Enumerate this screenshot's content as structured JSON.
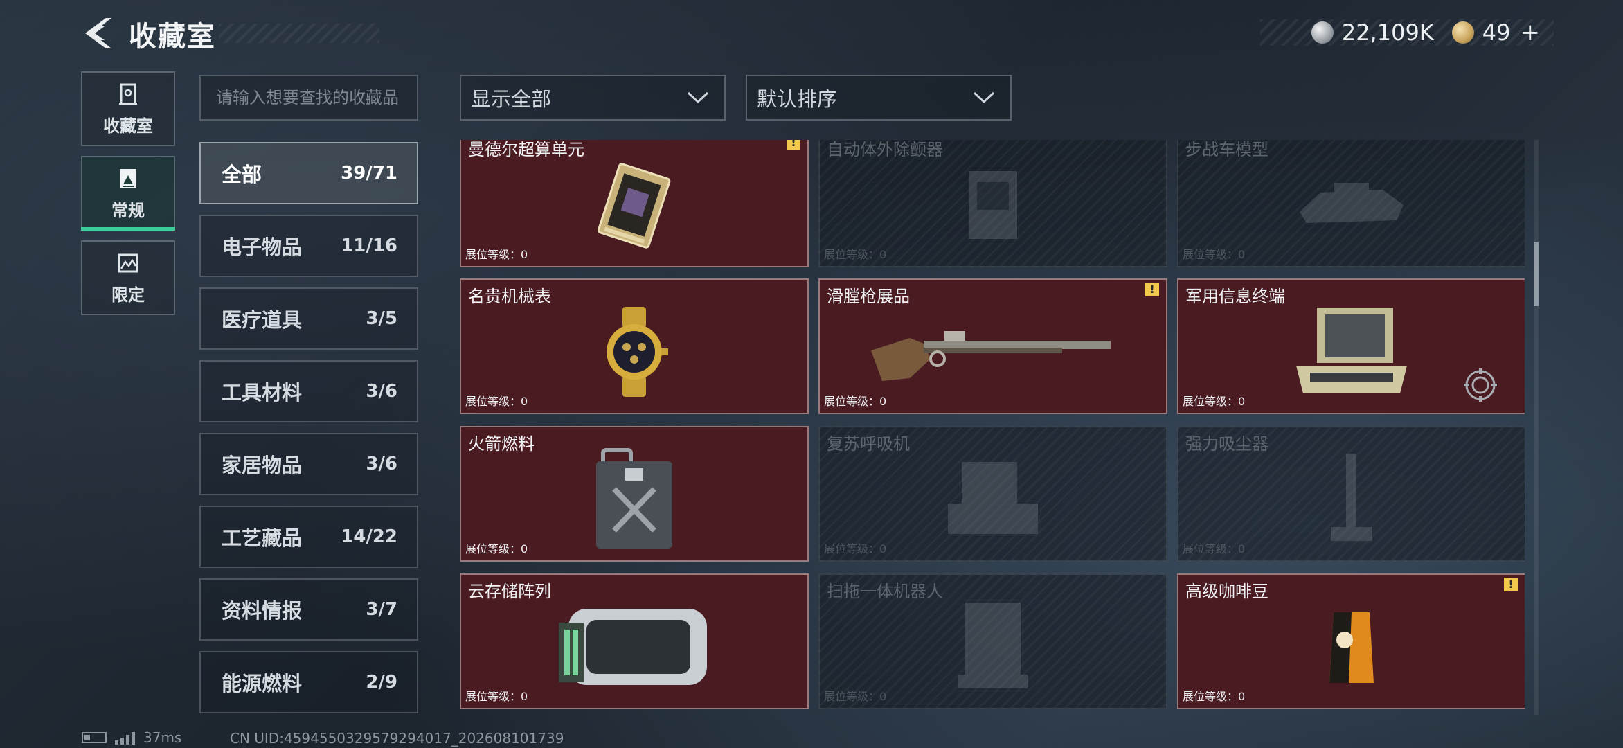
{
  "header": {
    "title": "收藏室",
    "currency_silver": "22,109K",
    "currency_gold": "49",
    "gold_plus": "+"
  },
  "rail": {
    "items": [
      {
        "label": "收藏室",
        "icon": "vault-icon"
      },
      {
        "label": "常规",
        "icon": "collection-icon",
        "active": true
      },
      {
        "label": "限定",
        "icon": "limited-icon"
      }
    ]
  },
  "search": {
    "placeholder": "请输入想要查找的收藏品"
  },
  "filters": {
    "display": "显示全部",
    "sort": "默认排序"
  },
  "categories": [
    {
      "name": "全部",
      "count": "39/71",
      "active": true
    },
    {
      "name": "电子物品",
      "count": "11/16"
    },
    {
      "name": "医疗道具",
      "count": "3/5"
    },
    {
      "name": "工具材料",
      "count": "3/6"
    },
    {
      "name": "家居物品",
      "count": "3/6"
    },
    {
      "name": "工艺藏品",
      "count": "14/22"
    },
    {
      "name": "资料情报",
      "count": "3/7"
    },
    {
      "name": "能源燃料",
      "count": "2/9"
    }
  ],
  "level_label": "展位等级：",
  "items": [
    {
      "name": "曼德尔超算单元",
      "level": "0",
      "owned": true,
      "warn": true,
      "icon": "processor-chip-icon"
    },
    {
      "name": "自动体外除颤器",
      "level": "0",
      "owned": false,
      "icon": "defibrillator-icon"
    },
    {
      "name": "步战车模型",
      "level": "0",
      "owned": false,
      "icon": "tank-model-icon"
    },
    {
      "name": "名贵机械表",
      "level": "0",
      "owned": true,
      "icon": "gold-watch-icon"
    },
    {
      "name": "滑膛枪展品",
      "level": "0",
      "owned": true,
      "warn": true,
      "icon": "musket-icon"
    },
    {
      "name": "军用信息终端",
      "level": "0",
      "owned": true,
      "target": true,
      "icon": "military-terminal-icon"
    },
    {
      "name": "火箭燃料",
      "level": "0",
      "owned": true,
      "icon": "fuel-canister-icon"
    },
    {
      "name": "复苏呼吸机",
      "level": "0",
      "owned": false,
      "icon": "ventilator-icon"
    },
    {
      "name": "强力吸尘器",
      "level": "0",
      "owned": false,
      "icon": "vacuum-icon"
    },
    {
      "name": "云存储阵列",
      "level": "0",
      "owned": true,
      "icon": "storage-array-icon"
    },
    {
      "name": "扫拖一体机器人",
      "level": "0",
      "owned": false,
      "icon": "robot-mop-icon"
    },
    {
      "name": "高级咖啡豆",
      "level": "0",
      "owned": true,
      "warn": true,
      "icon": "coffee-bag-icon"
    }
  ],
  "status": {
    "ping": "37ms",
    "uid": "CN UID:4594550329579294017_202608101739"
  },
  "colors": {
    "owned_card": "#4a1c22",
    "active_tab_accent": "#3ccf9a",
    "warn": "#f2c94c"
  }
}
